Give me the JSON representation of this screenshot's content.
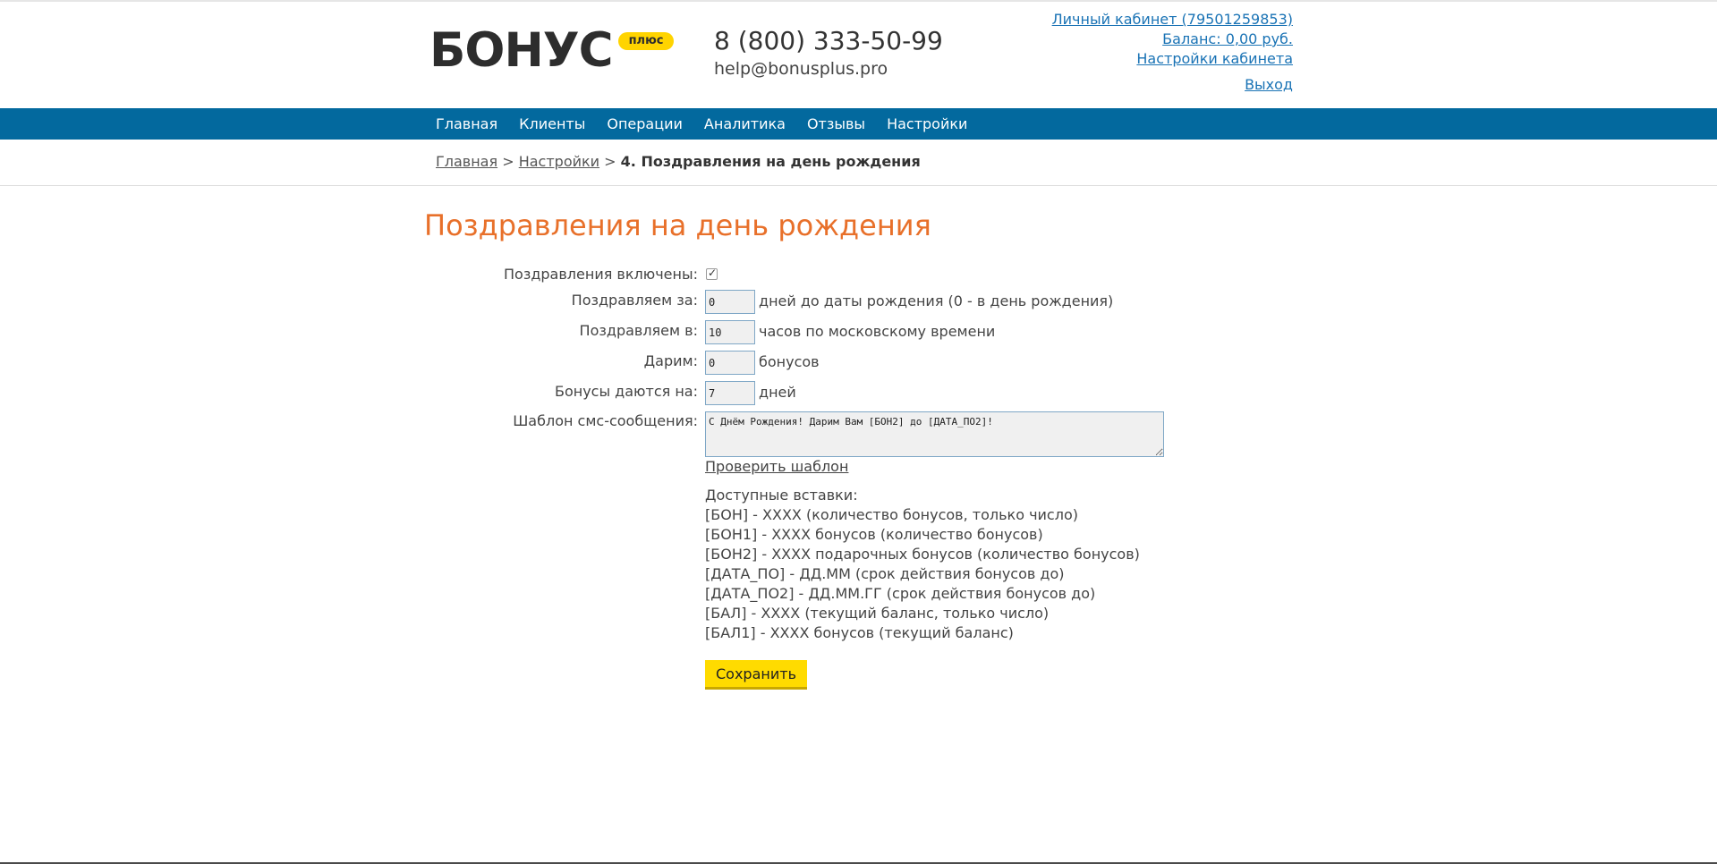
{
  "header": {
    "logo_word": "БОНУС",
    "logo_badge": "плюс",
    "phone": "8 (800) 333-50-99",
    "email": "help@bonusplus.pro",
    "account_link": "Личный кабинет (79501259853)",
    "balance_link": "Баланс: 0,00 руб.",
    "settings_link": "Настройки кабинета",
    "logout_link": "Выход"
  },
  "nav": {
    "items": [
      "Главная",
      "Клиенты",
      "Операции",
      "Аналитика",
      "Отзывы",
      "Настройки"
    ]
  },
  "breadcrumb": {
    "home": "Главная",
    "separator": ">",
    "settings": "Настройки",
    "current": "4. Поздравления на день рождения"
  },
  "page_title": "Поздравления на день рождения",
  "form": {
    "enabled_label": "Поздравления включены:",
    "enabled": true,
    "days_before_label": "Поздравляем за:",
    "days_before_value": "0",
    "days_before_suffix": "дней до даты рождения (0 - в день рождения)",
    "hour_label": "Поздравляем в:",
    "hour_value": "10",
    "hour_suffix": "часов по московскому времени",
    "bonus_label": "Дарим:",
    "bonus_value": "0",
    "bonus_suffix": "бонусов",
    "validity_label": "Бонусы даются на:",
    "validity_value": "7",
    "validity_suffix": "дней",
    "template_label": "Шаблон смс-сообщения:",
    "template_value": "С Днём Рождения! Дарим Вам [БОН2] до [ДАТА_ПО2]!",
    "check_template_link": "Проверить шаблон",
    "inserts_title": "Доступные вставки:",
    "inserts": [
      "[БОН] - XXXX (количество бонусов, только число)",
      "[БОН1] - XXXX бонусов (количество бонусов)",
      "[БОН2] - XXXX подарочных бонусов (количество бонусов)",
      "[ДАТА_ПО] - ДД.ММ (срок действия бонусов до)",
      "[ДАТА_ПО2] - ДД.ММ.ГГ (срок действия бонусов до)",
      "[БАЛ] - XXXX (текущий баланс, только число)",
      "[БАЛ1] - XXXX бонусов (текущий баланс)"
    ],
    "save_label": "Сохранить"
  },
  "colors": {
    "nav_bg": "#03699e",
    "title": "#e8702a",
    "link": "#1a73b5",
    "accent_yellow": "#ffdb00"
  }
}
